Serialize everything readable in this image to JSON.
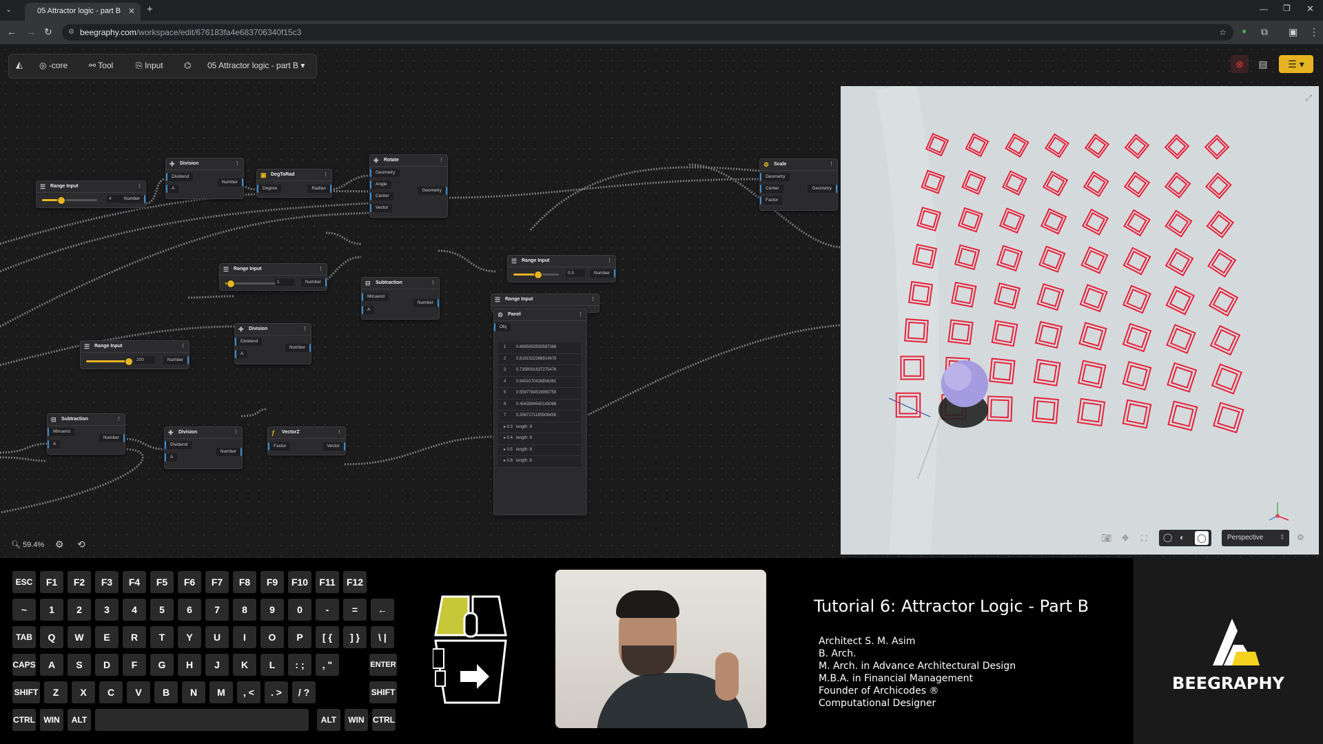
{
  "browser": {
    "tab_title": "05 Attractor logic - part B",
    "url_domain": "beegraphy.com",
    "url_path": "/workspace/edit/676183fa4e683706340f15c3"
  },
  "toolbar": {
    "core_label": "-core",
    "tool_label": "Tool",
    "input_label": "Input",
    "project_name": "05 Attractor logic - part B"
  },
  "zoom": "59.4%",
  "nodes": {
    "division1": {
      "title": "Division",
      "in1": "Dividend",
      "in2": "A",
      "out": "Number"
    },
    "degtorad": {
      "title": "DegToRad",
      "in1": "Degree",
      "out": "Radian"
    },
    "rotate": {
      "title": "Rotate",
      "in1": "Geometry",
      "in2": "Angle",
      "in3": "Center",
      "in4": "Vector",
      "out": "Geometry"
    },
    "scale": {
      "title": "Scale",
      "in1": "Geometry",
      "in2": "Center",
      "in3": "Factor",
      "out": "Geometry"
    },
    "range1": {
      "title": "Range Input",
      "value": "4",
      "out": "Number"
    },
    "range2": {
      "title": "Range Input",
      "value": "1",
      "out": "Number"
    },
    "range3": {
      "title": "Range Input",
      "value": "0.5",
      "out": "Number"
    },
    "range4": {
      "title": "Range Input",
      "value": "200",
      "out": "Number"
    },
    "range5": {
      "title": "Range Input"
    },
    "subtraction1": {
      "title": "Subtraction",
      "in1": "Minuend",
      "in2": "A",
      "out": "Number"
    },
    "division2": {
      "title": "Division",
      "in1": "Dividend",
      "in2": "A",
      "out": "Number"
    },
    "subtraction2": {
      "title": "Subtraction",
      "in1": "Minuend",
      "in2": "A",
      "out": "Number"
    },
    "division3": {
      "title": "Division",
      "in1": "Dividend",
      "in2": "A",
      "out": "Number"
    },
    "vectorz": {
      "title": "VectorZ",
      "in1": "Factor",
      "out": "Vector"
    },
    "panel": {
      "title": "Panel",
      "input": "Obj",
      "rows": [
        {
          "i": "1",
          "v": "0.8665653593587366"
        },
        {
          "i": "2",
          "v": "0.8161522368914976"
        },
        {
          "i": "3",
          "v": "0.7358001637275476"
        },
        {
          "i": "4",
          "v": "0.6453170428806361"
        },
        {
          "i": "5",
          "v": "0.5597784519950759"
        },
        {
          "i": "6",
          "v": "0.4543894540143086"
        },
        {
          "i": "7",
          "v": "0.3567271185508436"
        },
        {
          "i": "▸ 0.3",
          "v": "length: 8"
        },
        {
          "i": "▸ 0.4",
          "v": "length: 8"
        },
        {
          "i": "▸ 0.5",
          "v": "length: 8"
        },
        {
          "i": "▸ 0.6",
          "v": "length: 8"
        }
      ]
    }
  },
  "viewport": {
    "camera_mode": "Perspective"
  },
  "keyboard": {
    "row1": [
      "ESC",
      "F1",
      "F2",
      "F3",
      "F4",
      "F5",
      "F6",
      "F7",
      "F8",
      "F9",
      "F10",
      "F11",
      "F12"
    ],
    "row2": [
      "~",
      "1",
      "2",
      "3",
      "4",
      "5",
      "6",
      "7",
      "8",
      "9",
      "0",
      "-",
      "=",
      "←"
    ],
    "row3": [
      "TAB",
      "Q",
      "W",
      "E",
      "R",
      "T",
      "Y",
      "U",
      "I",
      "O",
      "P",
      "[ {",
      "] }",
      "\\ |"
    ],
    "row4": [
      "CAPS",
      "A",
      "S",
      "D",
      "F",
      "G",
      "H",
      "J",
      "K",
      "L",
      ": ;",
      ", \"",
      "ENTER"
    ],
    "row5": [
      "SHIFT",
      "Z",
      "X",
      "C",
      "V",
      "B",
      "N",
      "M",
      ", <",
      ". >",
      "/ ?",
      "SHIFT"
    ],
    "row6": [
      "CTRL",
      "WIN",
      "ALT",
      "ALT",
      "WIN",
      "CTRL"
    ]
  },
  "tutorial": {
    "title": "Tutorial 6: Attractor Logic - Part B",
    "bio": [
      "Architect S. M. Asim",
      "B. Arch.",
      "M. Arch. in Advance Architectural Design",
      "M.B.A. in Financial Management",
      "Founder of Archicodes ®",
      "Computational Designer"
    ]
  },
  "brand": {
    "name": "BEEGRAPHY"
  },
  "colors": {
    "accent": "#e6b422",
    "port": "#3b8ed1",
    "shape": "#e8203a",
    "logo_yellow": "#f5d21e"
  }
}
